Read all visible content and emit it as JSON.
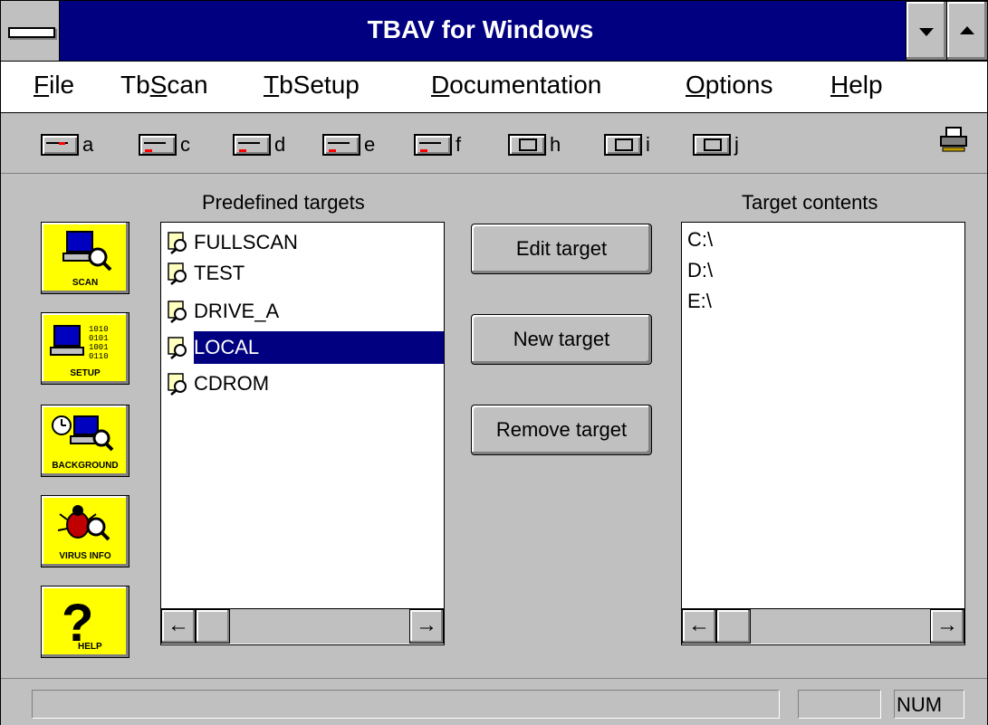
{
  "window": {
    "title": "TBAV for Windows"
  },
  "menu": [
    {
      "label": "File",
      "accel": "F",
      "rest": "ile"
    },
    {
      "label": "TbScan",
      "pre": "Tb",
      "accel": "S",
      "rest": "can"
    },
    {
      "label": "TbSetup",
      "pre": "",
      "accel": "T",
      "rest": "bSetup"
    },
    {
      "label": "Documentation",
      "accel": "D",
      "rest": "ocumentation"
    },
    {
      "label": "Options",
      "accel": "O",
      "rest": "ptions"
    },
    {
      "label": "Help",
      "accel": "H",
      "rest": "elp"
    }
  ],
  "toolbar": {
    "drives": [
      "a",
      "c",
      "d",
      "e",
      "f",
      "h",
      "i",
      "j"
    ],
    "printer_icon": "printer-icon"
  },
  "sidebar": [
    {
      "label": "SCAN",
      "icon": "scan-icon"
    },
    {
      "label": "SETUP",
      "icon": "setup-icon"
    },
    {
      "label": "BACKGROUND",
      "icon": "background-icon"
    },
    {
      "label": "VIRUS INFO",
      "icon": "virus-info-icon"
    },
    {
      "label": "HELP",
      "icon": "help-icon"
    }
  ],
  "targets": {
    "heading": "Predefined targets",
    "items": [
      "FULLSCAN",
      "TEST",
      "DRIVE_A",
      "LOCAL",
      "CDROM"
    ],
    "selected": "LOCAL"
  },
  "actions": {
    "edit": "Edit target",
    "new": "New target",
    "remove": "Remove target"
  },
  "contents": {
    "heading": "Target contents",
    "items": [
      "C:\\",
      "D:\\",
      "E:\\"
    ]
  },
  "status": {
    "num": "NUM"
  },
  "colors": {
    "titlebar": "#000080",
    "face": "#c0c0c0",
    "sidebar_button": "#ffff00",
    "selection": "#000080"
  }
}
